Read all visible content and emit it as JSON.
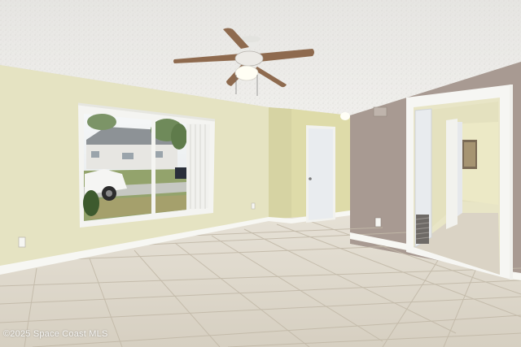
{
  "photo": {
    "watermark": "©2025 Space Coast MLS"
  },
  "colors": {
    "ceiling": "#ecebe8",
    "left_wall": "#e5e3c2",
    "back_wall": "#dcd9ad",
    "right_wall": "#a89a92",
    "floor": "#dbd5c8",
    "grout": "#c2b9a8",
    "trim": "#f7f7f3",
    "door": "#e9ecef",
    "fan_blade": "#8e6a4e"
  }
}
